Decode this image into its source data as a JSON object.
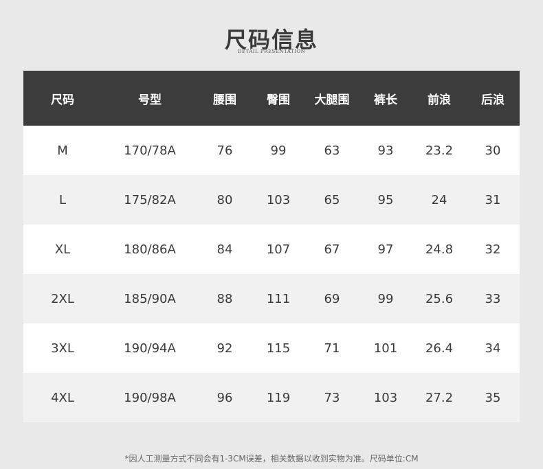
{
  "header": {
    "title": "尺码信息",
    "subtitle": "Detail presentation"
  },
  "table": {
    "columns": [
      "尺码",
      "号型",
      "腰围",
      "臀围",
      "大腿围",
      "裤长",
      "前浪",
      "后浪"
    ],
    "rows": [
      [
        "M",
        "170/78A",
        "76",
        "99",
        "63",
        "93",
        "23.2",
        "30"
      ],
      [
        "L",
        "175/82A",
        "80",
        "103",
        "65",
        "95",
        "24",
        "31"
      ],
      [
        "XL",
        "180/86A",
        "84",
        "107",
        "67",
        "97",
        "24.8",
        "32"
      ],
      [
        "2XL",
        "185/90A",
        "88",
        "111",
        "69",
        "99",
        "25.6",
        "33"
      ],
      [
        "3XL",
        "190/94A",
        "92",
        "115",
        "71",
        "101",
        "26.4",
        "34"
      ],
      [
        "4XL",
        "190/98A",
        "96",
        "119",
        "73",
        "103",
        "27.2",
        "35"
      ]
    ]
  },
  "footnote": "*因人工测量方式不同会有1-3CM误差，相关数据以收到实物为准。尺码单位:CM",
  "colors": {
    "header_bg": "#3c3c3c",
    "page_bg": "#e9e9e9",
    "row_odd": "#ffffff",
    "row_even": "#f1f1f1"
  }
}
